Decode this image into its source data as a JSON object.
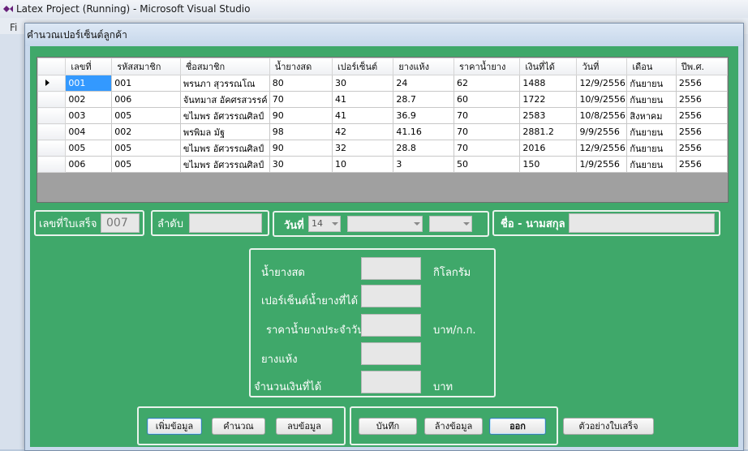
{
  "vs": {
    "title": "Latex Project (Running) - Microsoft Visual Studio",
    "menu_fi": "Fi"
  },
  "form": {
    "title": "คำนวณเปอร์เซ็นต์ลูกค้า"
  },
  "grid": {
    "columns": [
      "เลขที่",
      "รหัสสมาชิก",
      "ชื่อสมาชิก",
      "น้ำยางสด",
      "เปอร์เซ็นต์",
      "ยางแห้ง",
      "ราคาน้ำยาง",
      "เงินที่ได้",
      "วันที่",
      "เดือน",
      "ปีพ.ศ."
    ],
    "rows": [
      [
        "001",
        "001",
        "พรนภา สุวรรณโณ",
        "80",
        "30",
        "24",
        "62",
        "1488",
        "12/9/2556",
        "กันยายน",
        "2556"
      ],
      [
        "002",
        "006",
        "จันทมาส อัคศรสวรรค์",
        "70",
        "41",
        "28.7",
        "60",
        "1722",
        "10/9/2556",
        "กันยายน",
        "2556"
      ],
      [
        "003",
        "005",
        "ขไมพร อัศวรรณศิลป์",
        "90",
        "41",
        "36.9",
        "70",
        "2583",
        "10/8/2556",
        "สิงหาคม",
        "2556"
      ],
      [
        "004",
        "002",
        "พรพิมล มัฐ",
        "98",
        "42",
        "41.16",
        "70",
        "2881.2",
        "9/9/2556",
        "กันยายน",
        "2556"
      ],
      [
        "005",
        "005",
        "ขไมพร อัศวรรณศิลป์",
        "90",
        "32",
        "28.8",
        "70",
        "2016",
        "12/9/2556",
        "กันยายน",
        "2556"
      ],
      [
        "006",
        "005",
        "ขไมพร อัศวรรณศิลป์",
        "30",
        "10",
        "3",
        "50",
        "150",
        "1/9/2556",
        "กันยายน",
        "2556"
      ]
    ]
  },
  "fields": {
    "receipt_label": "เลขที่ใบเสร็จ",
    "receipt_value": "007",
    "order_label": "ลำดับ",
    "date_label": "วันที่",
    "day_value": "14",
    "name_label": "ชื่อ - นามสกุล",
    "fresh_latex_label": "น้ำยางสด",
    "fresh_latex_unit": "กิโลกรัม",
    "percent_label": "เปอร์เซ็นต์น้ำยางที่ได้",
    "price_label": "ราคาน้ำยางประจำวัน",
    "price_unit": "บาท/ก.ก.",
    "dry_rubber_label": "ยางแห้ง",
    "amount_label": "จำนวนเงินที่ได้",
    "amount_unit": "บาท"
  },
  "buttons": {
    "add": "เพิ่มข้อมูล",
    "calculate": "คำนวณ",
    "delete": "ลบข้อมูล",
    "save": "บันทึก",
    "clear": "ล้างข้อมูล",
    "exit": "ออก",
    "receipt_sample": "ตัวอย่างใบเสร็จ"
  },
  "colors": {
    "form_green": "#3fa86a",
    "selection_blue": "#3399ff"
  }
}
